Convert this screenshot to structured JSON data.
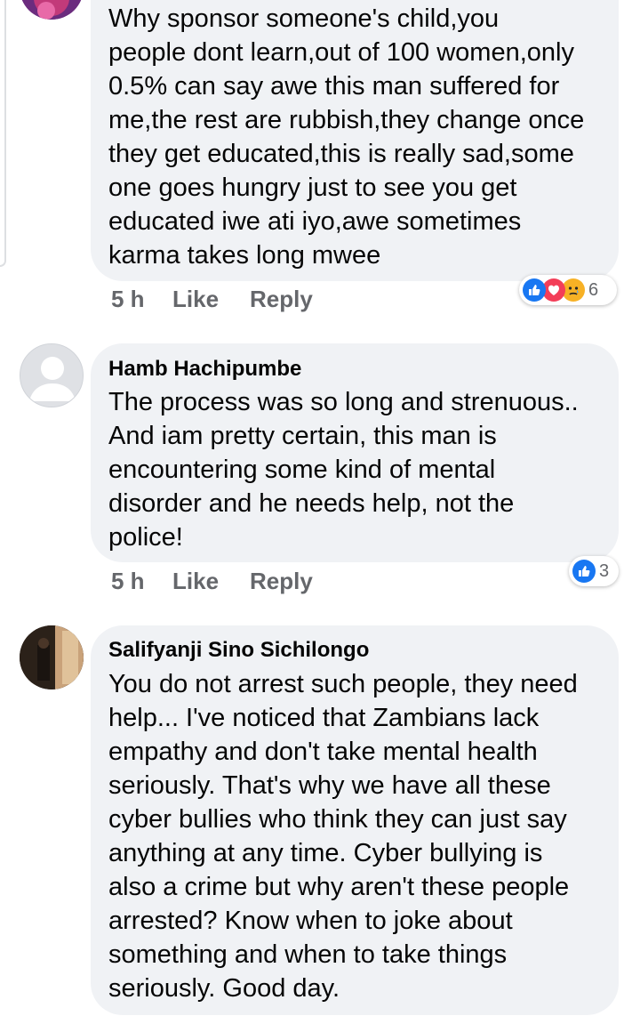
{
  "comments": [
    {
      "author": "",
      "text": "Why sponsor someone's child,you\npeople dont learn,out of 100 women,only\n0.5% can say awe this man suffered for\nme,the rest are rubbish,they change once\nthey get educated,this is really sad,some\none goes hungry just to see you get\neducated iwe ati iyo,awe sometimes\nkarma takes long mwee",
      "time": "5 h",
      "like_label": "Like",
      "reply_label": "Reply",
      "reactions": [
        "like-icon",
        "love-icon",
        "sad-icon"
      ],
      "reaction_count": "6"
    },
    {
      "author": "Hamb Hachipumbe",
      "text": "The process was so long and strenuous..\nAnd iam pretty certain, this man is\nencountering some kind of mental\ndisorder and he needs help, not the\npolice!",
      "time": "5 h",
      "like_label": "Like",
      "reply_label": "Reply",
      "reactions": [
        "like-icon"
      ],
      "reaction_count": "3"
    },
    {
      "author": "Salifyanji Sino Sichilongo",
      "text": "You do not arrest such people,  they need\nhelp... I've noticed that Zambians lack\nempathy and don't take mental health\nseriously. That's why we have all these\ncyber bullies who think they can just say\nanything at any time. Cyber bullying is\nalso a crime but why aren't these people\narrested? Know when to joke about\nsomething and when to take things\nseriously. Good day."
    }
  ],
  "colors": {
    "bubble": "#f0f2f5",
    "meta": "#65676b",
    "like_blue": "#1877f2",
    "love_red": "#f33e58",
    "sad_yellow": "#f7b125"
  }
}
